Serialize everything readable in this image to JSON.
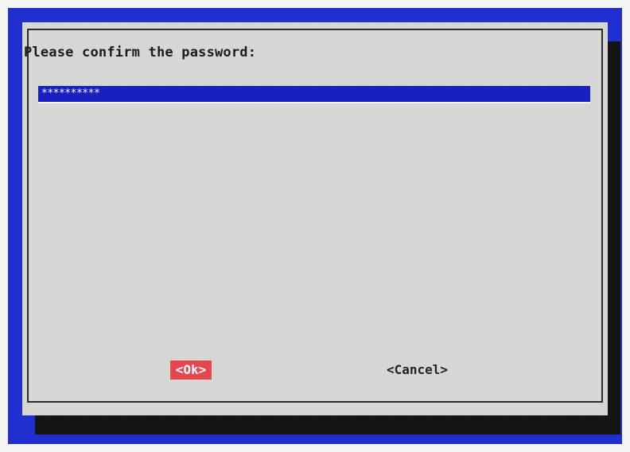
{
  "dialog": {
    "prompt": "Please confirm the password:",
    "password_mask": "**********"
  },
  "buttons": {
    "ok_label": "<Ok>",
    "cancel_label": "<Cancel>"
  },
  "colors": {
    "background": "#1f2fd0",
    "dialog": "#d8d8d4",
    "input": "#1a1fc0",
    "ok_button": "#e4474f"
  }
}
